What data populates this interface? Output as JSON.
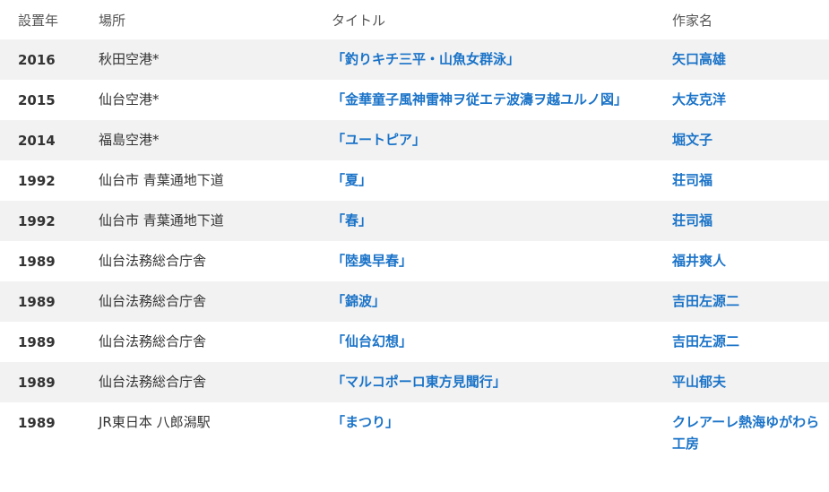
{
  "table": {
    "headers": {
      "year": "設置年",
      "place": "場所",
      "title": "タイトル",
      "artist": "作家名"
    },
    "rows": [
      {
        "year": "2016",
        "place": "秋田空港*",
        "title": "「釣りキチ三平・山魚女群泳」",
        "artist": "矢口高雄"
      },
      {
        "year": "2015",
        "place": "仙台空港*",
        "title": "「金華童子風神雷神ヲ従エテ波濤ヲ越ユルノ図」",
        "artist": "大友克洋"
      },
      {
        "year": "2014",
        "place": "福島空港*",
        "title": "「ユートピア」",
        "artist": "堀文子"
      },
      {
        "year": "1992",
        "place": "仙台市 青葉通地下道",
        "title": "「夏」",
        "artist": "荘司福"
      },
      {
        "year": "1992",
        "place": "仙台市 青葉通地下道",
        "title": "「春」",
        "artist": "荘司福"
      },
      {
        "year": "1989",
        "place": "仙台法務総合庁舎",
        "title": "「陸奥早春」",
        "artist": "福井爽人"
      },
      {
        "year": "1989",
        "place": "仙台法務総合庁舎",
        "title": "「錦波」",
        "artist": "吉田左源二"
      },
      {
        "year": "1989",
        "place": "仙台法務総合庁舎",
        "title": "「仙台幻想」",
        "artist": "吉田左源二"
      },
      {
        "year": "1989",
        "place": "仙台法務総合庁舎",
        "title": "「マルコポーロ東方見聞行」",
        "artist": "平山郁夫"
      },
      {
        "year": "1989",
        "place": "JR東日本 八郎潟駅",
        "title": "「まつり」",
        "artist": "クレアーレ熱海ゆがわら工房"
      }
    ]
  },
  "colors": {
    "link": "#1a73c8",
    "stripe": "#f2f2f2",
    "text": "#333333"
  }
}
